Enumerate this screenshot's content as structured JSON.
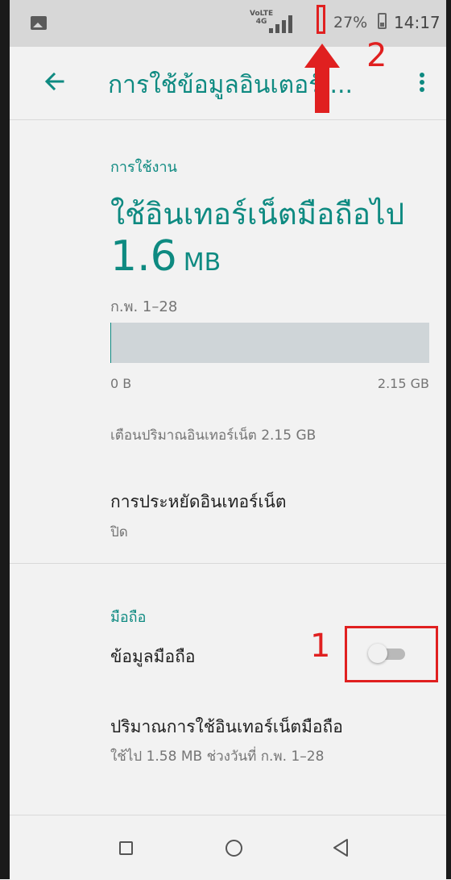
{
  "status_bar": {
    "app_icon": "image-icon",
    "volte_label": "VoLTE",
    "network_label": "4G",
    "battery_percent": "27%",
    "time": "14:17"
  },
  "toolbar": {
    "back_icon": "arrow-left-icon",
    "title": "การใช้ข้อมูลอินเตอร์เ...",
    "overflow_icon": "more-vert-icon"
  },
  "usage": {
    "section_label": "การใช้งาน",
    "headline": "ใช้อินเทอร์เน็ตมือถือไป",
    "amount_value": "1.6",
    "amount_unit": "MB",
    "date_range": "ก.พ. 1–28",
    "bar_fill_fraction": 0.0007,
    "bar_min_label": "0 B",
    "bar_max_label": "2.15 GB",
    "warning_text": "เตือนปริมาณอินเทอร์เน็ต 2.15 GB"
  },
  "data_saver": {
    "title": "การประหยัดอินเทอร์เน็ต",
    "summary": "ปิด"
  },
  "mobile": {
    "section_label": "มือถือ",
    "mobile_data_title": "ข้อมูลมือถือ",
    "mobile_data_enabled": false,
    "usage_title": "ปริมาณการใช้อินเทอร์เน็ตมือถือ",
    "usage_summary": "ใช้ไป 1.58 MB ช่วงวันที่ ก.พ. 1–28"
  },
  "annotations": {
    "label_1": "1",
    "label_2": "2",
    "color": "#e02020"
  },
  "nav_bar": {
    "recents_icon": "square-icon",
    "home_icon": "circle-icon",
    "back_icon": "triangle-back-icon"
  },
  "colors": {
    "accent": "#0e8a81",
    "background": "#f2f2f2"
  }
}
